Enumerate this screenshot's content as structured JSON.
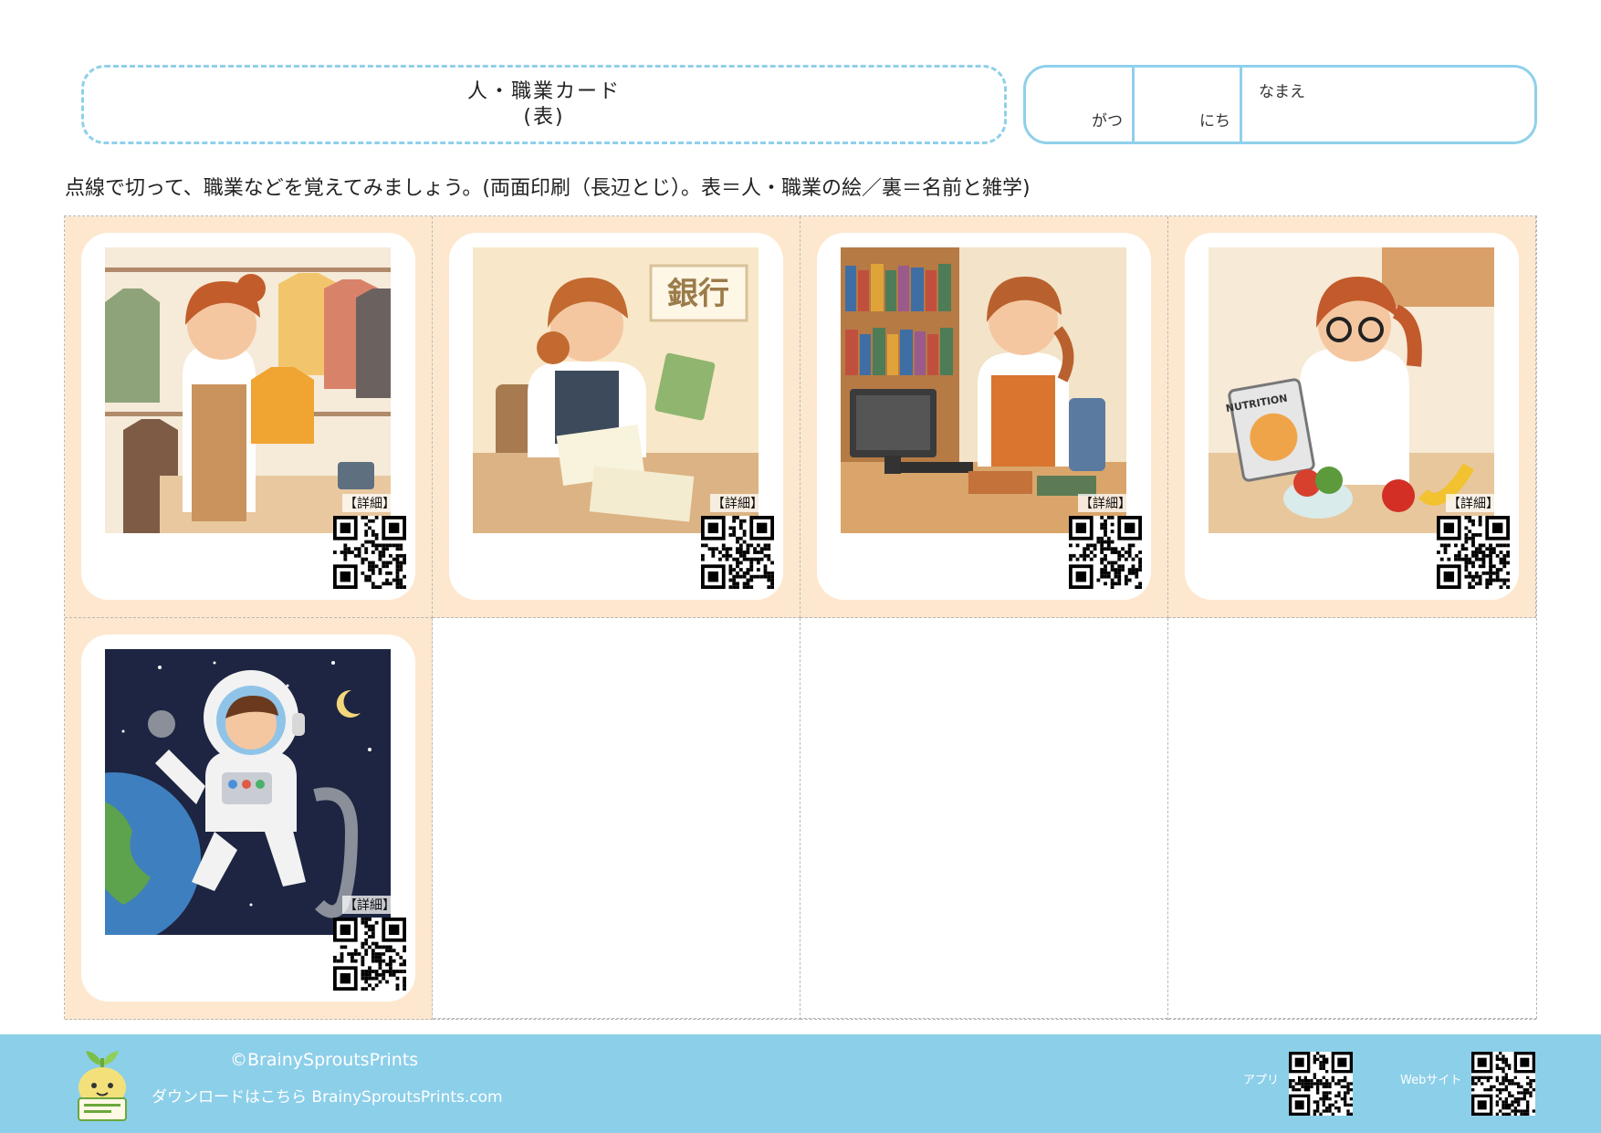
{
  "header": {
    "title_line1": "人・職業カード",
    "title_line2": "(表)",
    "month_label": "がつ",
    "day_label": "にち",
    "name_label": "なまえ"
  },
  "instruction": "点線で切って、職業などを覚えてみましょう。(両面印刷（長辺とじ）。表＝人・職業の絵／裏＝名前と雑学)",
  "cards": [
    {
      "scene": "clothing-shop-icon",
      "detail_label": "【詳細】",
      "sign_text": ""
    },
    {
      "scene": "bank-teller-icon",
      "detail_label": "【詳細】",
      "sign_text": "銀行"
    },
    {
      "scene": "librarian-icon",
      "detail_label": "【詳細】",
      "sign_text": ""
    },
    {
      "scene": "nutritionist-icon",
      "detail_label": "【詳細】",
      "sign_text": "NUTRITION"
    },
    {
      "scene": "astronaut-icon",
      "detail_label": "【詳細】",
      "sign_text": ""
    }
  ],
  "footer": {
    "copyright": "©BrainySproutsPrints",
    "download": "ダウンロードはこちら BrainySproutsPrints.com",
    "app_label": "アプリ",
    "web_label": "Webサイト"
  },
  "colors": {
    "accent_blue": "#8fd0ea",
    "footer_blue": "#8ccfe9",
    "card_bg": "#fde8cf"
  }
}
